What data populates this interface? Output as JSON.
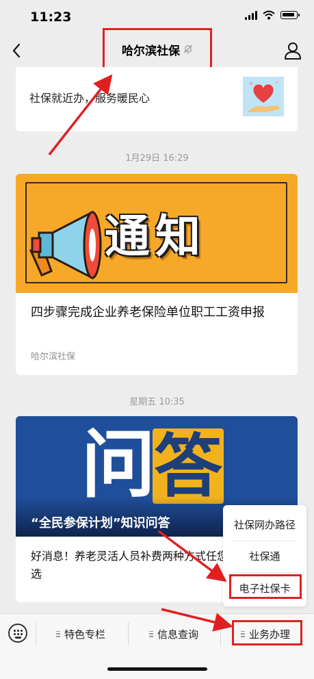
{
  "status_bar": {
    "time": "11:23"
  },
  "nav": {
    "title": "哈尔滨社保"
  },
  "messages": [
    {
      "text": "社保就近办，服务暖民心"
    },
    {
      "timestamp": "1月29日 16:29",
      "banner_text": "通知",
      "title": "四步骤完成企业养老保险单位职工工资申报",
      "source": "哈尔滨社保"
    },
    {
      "timestamp": "星期五 10:35",
      "banner_left": "问",
      "banner_right": "答",
      "banner_caption": "“全民参保计划”知识问答",
      "title": "好消息！养老灵活人员补费两种方式任您选"
    }
  ],
  "submenu": {
    "items": [
      "社保网办路径",
      "社保通",
      "电子社保卡"
    ],
    "highlighted": "电子社保卡"
  },
  "bottom_menu": {
    "tabs": [
      "特色专栏",
      "信息查询",
      "业务办理"
    ],
    "highlighted": "业务办理"
  },
  "annotation_color": "#e02020"
}
